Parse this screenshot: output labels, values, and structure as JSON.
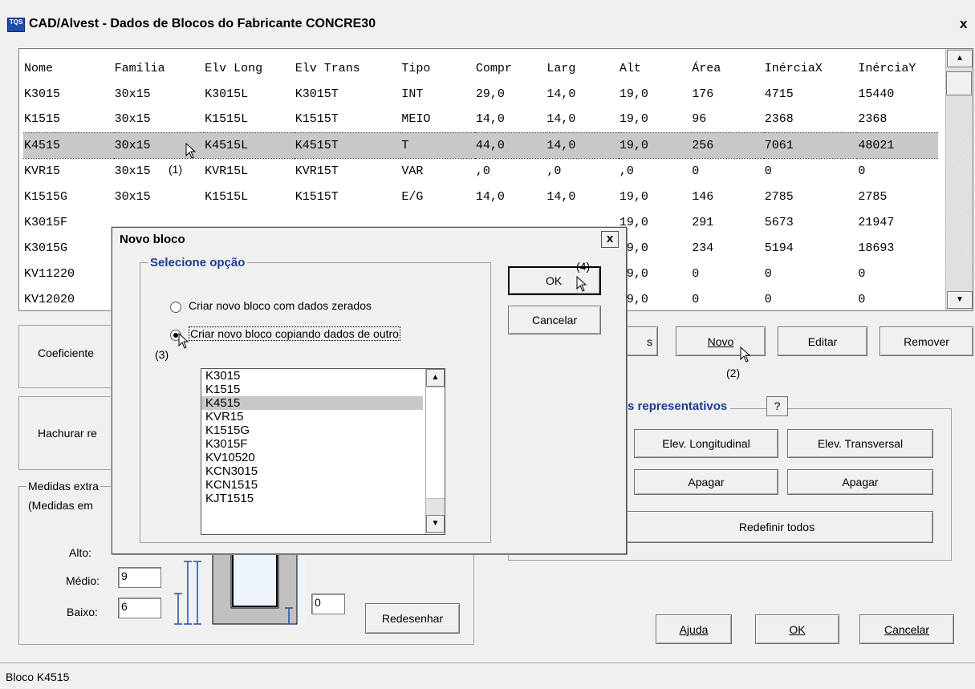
{
  "window": {
    "title": "CAD/Alvest - Dados de Blocos do Fabricante  CONCRE30",
    "icon_text_top": "TQS",
    "close_glyph": "x"
  },
  "table": {
    "headers": [
      "Nome",
      "Família",
      "Elv Long",
      "Elv Trans",
      "Tipo",
      "Compr",
      "Larg",
      "Alt",
      "Área",
      "InérciaX",
      "InérciaY"
    ],
    "rows": [
      [
        "K3015",
        "30x15",
        "K3015L",
        "K3015T",
        "INT",
        "29,0",
        "14,0",
        "19,0",
        "176",
        "4715",
        "15440"
      ],
      [
        "K1515",
        "30x15",
        "K1515L",
        "K1515T",
        "MEIO",
        "14,0",
        "14,0",
        "19,0",
        "96",
        "2368",
        "2368"
      ],
      [
        "K4515",
        "30x15",
        "K4515L",
        "K4515T",
        "T",
        "44,0",
        "14,0",
        "19,0",
        "256",
        "7061",
        "48021"
      ],
      [
        "KVR15",
        "30x15",
        "KVR15L",
        "KVR15T",
        "VAR",
        ",0",
        ",0",
        ",0",
        "0",
        "0",
        "0"
      ],
      [
        "K1515G",
        "30x15",
        "K1515L",
        "K1515T",
        "E/G",
        "14,0",
        "14,0",
        "19,0",
        "146",
        "2785",
        "2785"
      ],
      [
        "K3015F",
        "",
        "",
        "",
        "",
        "",
        "",
        "19,0",
        "291",
        "5673",
        "21947"
      ],
      [
        "K3015G",
        "",
        "",
        "",
        "",
        "",
        "",
        "19,0",
        "234",
        "5194",
        "18693"
      ],
      [
        "KV11220",
        "",
        "",
        "",
        "",
        "",
        "",
        "19,0",
        "0",
        "0",
        "0"
      ],
      [
        "KV12020",
        "",
        "",
        "",
        "",
        "",
        "",
        "19,0",
        "0",
        "0",
        "0"
      ]
    ],
    "selected_row": 2,
    "annotation_1": "(1)"
  },
  "buttons": {
    "partial_left": "s",
    "novo": "Novo",
    "editar": "Editar",
    "remover": "Remover",
    "annotation_2": "(2)",
    "ajuda": "Ajuda",
    "ok": "OK",
    "cancelar": "Cancelar",
    "redesenhar": "Redesenhar"
  },
  "representativos": {
    "title": "s representativos",
    "help": "?",
    "elev_long": "Elev. Longitudinal",
    "elev_trans": "Elev. Transversal",
    "apagar_1": "Apagar",
    "apagar_2": "Apagar",
    "redefinir": "Redefinir todos"
  },
  "left_panels": {
    "coeficiente": "Coeficiente",
    "hachurar": "Hachurar re",
    "medidas_title": "Medidas extra",
    "medidas_sub": "(Medidas em",
    "alto_label": "Alto:",
    "medio_label": "Médio:",
    "medio_value": "9",
    "baixo_label": "Baixo:",
    "baixo_value": "6",
    "extra_value": "0"
  },
  "dialog": {
    "title": "Novo bloco",
    "close": "x",
    "group_title": "Selecione opção",
    "option_zero": "Criar novo bloco com dados zerados",
    "option_copy": "Criar novo bloco copiando dados de outro",
    "ok": "OK",
    "cancel": "Cancelar",
    "annotation_3": "(3)",
    "annotation_4": "(4)",
    "list_items": [
      "K3015",
      "K1515",
      "K4515",
      "KVR15",
      "K1515G",
      "K3015F",
      "KV10520",
      "KCN3015",
      "KCN1515",
      "KJT1515"
    ],
    "list_selected": 2
  },
  "status_bar": {
    "text": "Bloco K4515"
  }
}
